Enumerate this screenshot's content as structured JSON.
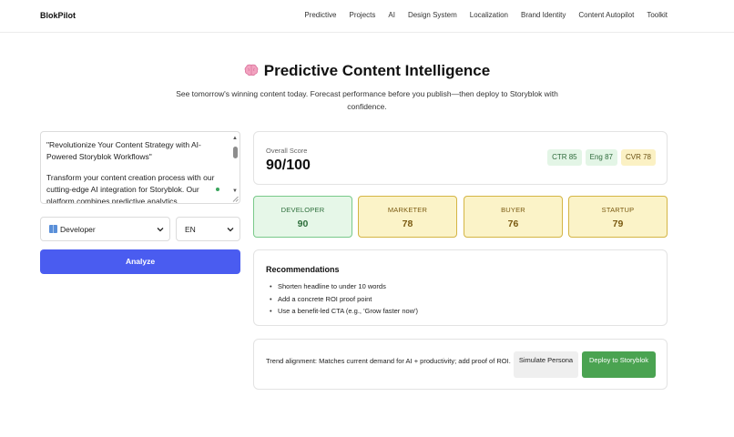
{
  "header": {
    "brand": "BlokPilot",
    "nav": [
      "Predictive",
      "Projects",
      "AI",
      "Design System",
      "Localization",
      "Brand Identity",
      "Content Autopilot",
      "Toolkit"
    ]
  },
  "hero": {
    "icon": "brain-icon",
    "title": "Predictive Content Intelligence",
    "subtitle": "See tomorrow's winning content today. Forecast performance before you publish—then deploy to Storyblok with confidence."
  },
  "editor": {
    "headline": "\"Revolutionize Your Content Strategy with AI-Powered Storyblok Workflows\"",
    "body": "Transform your content creation process with our cutting-edge AI integration for Storyblok. Our platform combines predictive analytics"
  },
  "controls": {
    "persona_icon": "book-icon",
    "persona_value": "Developer",
    "language_value": "EN",
    "analyze_label": "Analyze"
  },
  "score": {
    "label": "Overall Score",
    "value": "90/100",
    "metrics": [
      {
        "label": "CTR 85",
        "color": "#e3f5e6"
      },
      {
        "label": "Eng 87",
        "color": "#e3f5e6"
      },
      {
        "label": "CVR 78",
        "color": "#fbf1c4"
      }
    ]
  },
  "personas": [
    {
      "name": "DEVELOPER",
      "score": "90"
    },
    {
      "name": "MARKETER",
      "score": "78"
    },
    {
      "name": "BUYER",
      "score": "76"
    },
    {
      "name": "STARTUP",
      "score": "79"
    }
  ],
  "recommendations": {
    "title": "Recommendations",
    "items": [
      "Shorten headline to under 10 words",
      "Add a concrete ROI proof point",
      "Use a benefit-led CTA (e.g., 'Grow faster now')"
    ]
  },
  "trend": {
    "text": "Trend alignment: Matches current demand for AI + productivity; add proof of ROI.",
    "simulate_label": "Simulate Persona",
    "deploy_label": "Deploy to Storyblok"
  },
  "colors": {
    "accent": "#4a5cf0",
    "success": "#4aa351",
    "good_bg": "#e6f7e8",
    "warn_bg": "#fbf3c8"
  }
}
